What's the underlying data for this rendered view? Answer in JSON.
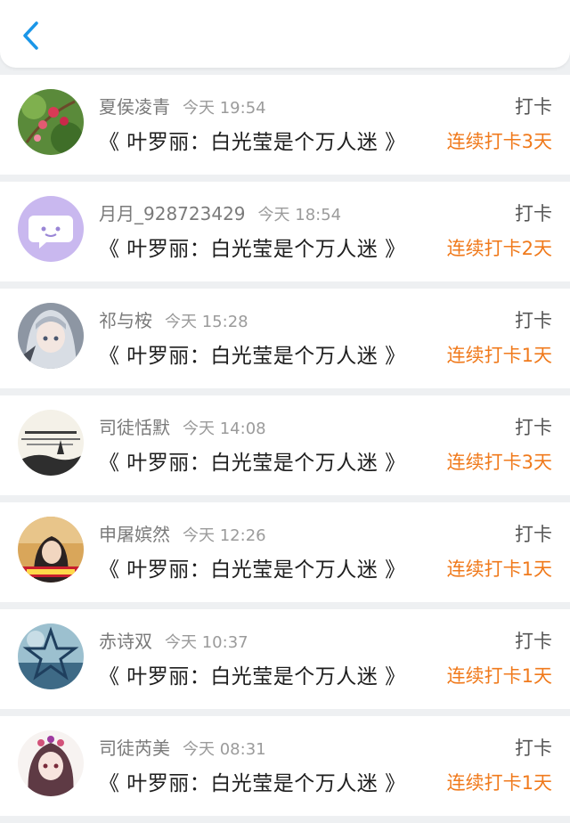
{
  "header": {
    "back_icon": "chevron-left-icon",
    "accent": "#1a96e8"
  },
  "streak_color": "#f07a1c",
  "records": [
    {
      "name": "夏侯凌青",
      "time": "今天 19:54",
      "book": "《 叶罗丽：白光莹是个万人迷 》",
      "action": "打卡",
      "streak": "连续打卡3天",
      "avatar": "flower-avatar"
    },
    {
      "name": "月月_928723429",
      "time": "今天 18:54",
      "book": "《 叶罗丽：白光莹是个万人迷 》",
      "action": "打卡",
      "streak": "连续打卡2天",
      "avatar": "chat-bubble-avatar"
    },
    {
      "name": "祁与桉",
      "time": "今天 15:28",
      "book": "《 叶罗丽：白光莹是个万人迷 》",
      "action": "打卡",
      "streak": "连续打卡1天",
      "avatar": "anime-girl-avatar"
    },
    {
      "name": "司徒恬默",
      "time": "今天 14:08",
      "book": "《 叶罗丽：白光莹是个万人迷 》",
      "action": "打卡",
      "streak": "连续打卡3天",
      "avatar": "text-landscape-avatar"
    },
    {
      "name": "申屠嫔然",
      "time": "今天 12:26",
      "book": "《 叶罗丽：白光莹是个万人迷 》",
      "action": "打卡",
      "streak": "连续打卡1天",
      "avatar": "portrait-avatar"
    },
    {
      "name": "赤诗双",
      "time": "今天 10:37",
      "book": "《 叶罗丽：白光莹是个万人迷 》",
      "action": "打卡",
      "streak": "连续打卡1天",
      "avatar": "star-avatar"
    },
    {
      "name": "司徒芮美",
      "time": "今天 08:31",
      "book": "《 叶罗丽：白光莹是个万人迷 》",
      "action": "打卡",
      "streak": "连续打卡1天",
      "avatar": "sketch-girl-avatar"
    }
  ]
}
